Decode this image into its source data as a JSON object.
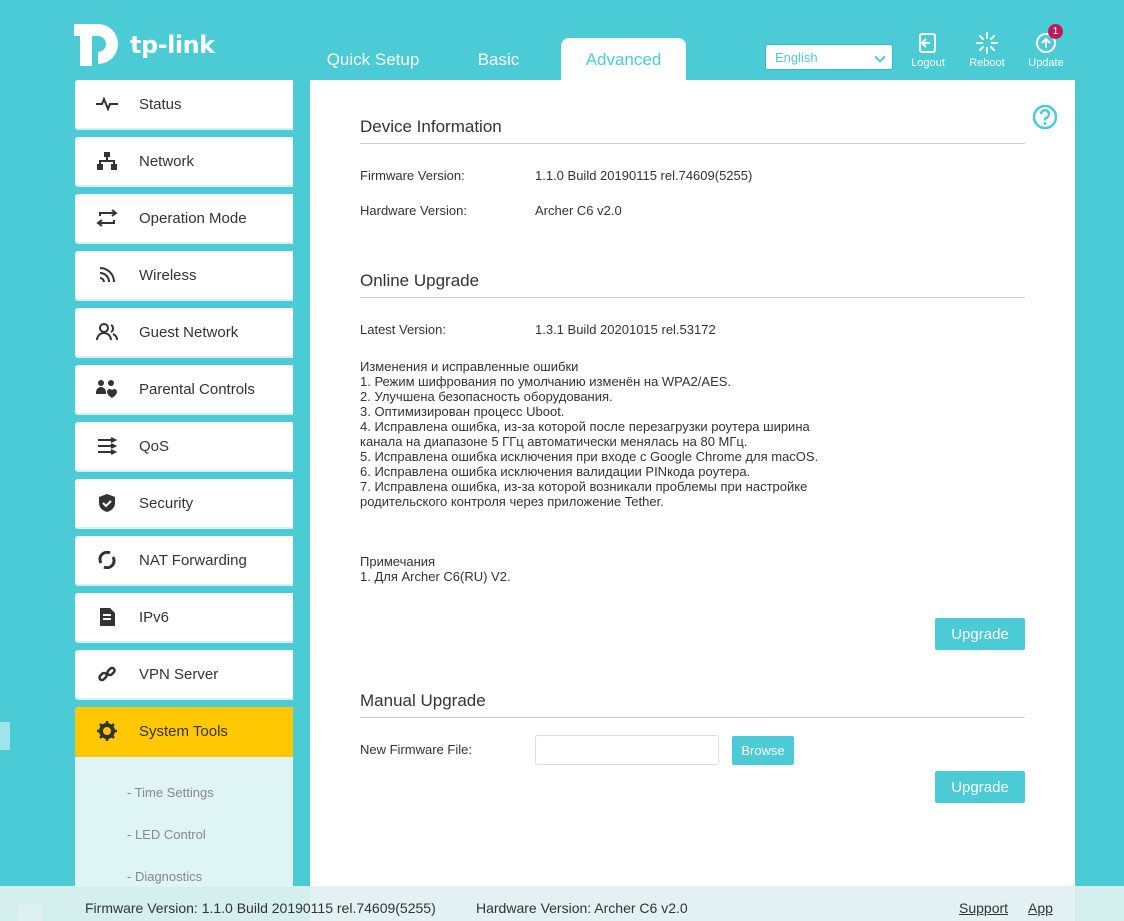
{
  "brand": {
    "name": "tp-link"
  },
  "topnav": {
    "tabs": [
      {
        "label": "Quick Setup"
      },
      {
        "label": "Basic"
      },
      {
        "label": "Advanced"
      }
    ]
  },
  "language": {
    "selected": "English"
  },
  "header_buttons": {
    "logout": "Logout",
    "reboot": "Reboot",
    "update": "Update",
    "update_badge": "1"
  },
  "sidebar": {
    "items": [
      {
        "label": "Status",
        "icon": "pulse-icon"
      },
      {
        "label": "Network",
        "icon": "network-icon"
      },
      {
        "label": "Operation Mode",
        "icon": "switch-mode-icon"
      },
      {
        "label": "Wireless",
        "icon": "wifi-icon"
      },
      {
        "label": "Guest Network",
        "icon": "guest-users-icon"
      },
      {
        "label": "Parental Controls",
        "icon": "parental-icon"
      },
      {
        "label": "QoS",
        "icon": "qos-icon"
      },
      {
        "label": "Security",
        "icon": "shield-icon"
      },
      {
        "label": "NAT Forwarding",
        "icon": "nat-icon"
      },
      {
        "label": "IPv6",
        "icon": "ipv6-icon"
      },
      {
        "label": "VPN Server",
        "icon": "link-icon"
      },
      {
        "label": "System Tools",
        "icon": "gear-icon"
      }
    ],
    "submenu": [
      "- Time Settings",
      "- LED Control",
      "- Diagnostics"
    ]
  },
  "device_info": {
    "title": "Device Information",
    "firmware_label": "Firmware Version:",
    "firmware_value": "1.1.0 Build 20190115 rel.74609(5255)",
    "hardware_label": "Hardware Version:",
    "hardware_value": "Archer C6 v2.0"
  },
  "online_upgrade": {
    "title": "Online Upgrade",
    "latest_label": "Latest Version:",
    "latest_value": "1.3.1 Build 20201015 rel.53172",
    "changes": [
      "Изменения и исправленные ошибки",
      "1. Режим шифрования по умолчанию изменён на WPA2/AES.",
      "2. Улучшена безопасность оборудования.",
      "3. Оптимизирован процесс Uboot.",
      "4. Исправлена ошибка, из-за которой после перезагрузки роутера ширина",
      "канала на диапазоне 5 ГГц автоматически менялась на 80 МГц.",
      "5. Исправлена ошибка исключения при входе с Google Chrome для macOS.",
      "6. Исправлена ошибка исключения валидации PINкода роутера.",
      "7. Исправлена ошибка, из-за которой возникали проблемы при настройке",
      "родительского контроля через приложение Tether."
    ],
    "notes": [
      "Примечания",
      "1. Для Archer C6(RU) V2."
    ],
    "upgrade_button": "Upgrade"
  },
  "manual_upgrade": {
    "title": "Manual Upgrade",
    "file_label": "New Firmware File:",
    "file_value": "",
    "browse_button": "Browse",
    "upgrade_button": "Upgrade"
  },
  "footer": {
    "firmware": "Firmware Version: 1.1.0 Build 20190115 rel.74609(5255)",
    "hardware": "Hardware Version: Archer C6 v2.0",
    "support": "Support",
    "app": "App"
  },
  "colors": {
    "accent": "#4acbd6",
    "active_menu": "#ffc800",
    "badge": "#c0185a"
  }
}
